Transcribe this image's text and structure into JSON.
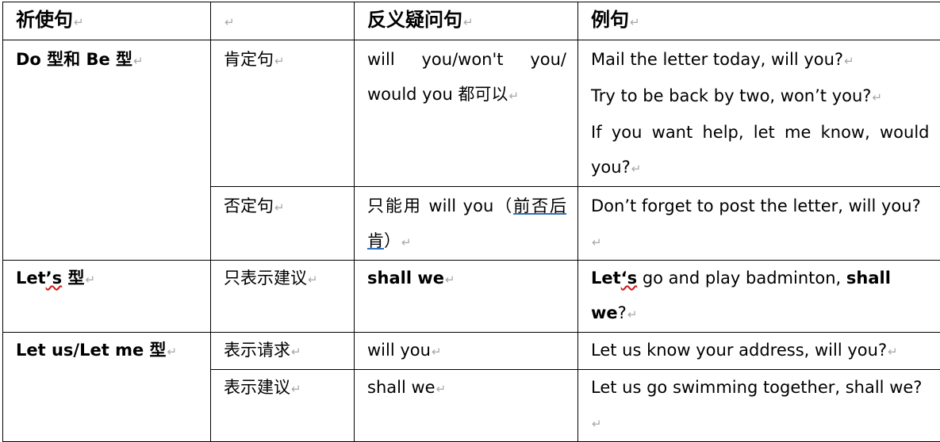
{
  "paragraph_mark": "↵",
  "headers": {
    "c1": "祈使句",
    "c2": "",
    "c3": "反义疑问句",
    "c4": "例句"
  },
  "rows": {
    "do_be": {
      "type": "Do 型和 Be 型",
      "affirm": {
        "kind": "肯定句",
        "tag": "will you/won't you/ would you 都可以",
        "examples": [
          "Mail the letter today, will you?",
          "Try to be back by two, won’t you?",
          "If you want help, let me know, would you?"
        ]
      },
      "neg": {
        "kind": "否定句",
        "tag_a": "只能用 will you（",
        "tag_b": "前否后肯",
        "tag_c": "）",
        "example": "Don’t forget to post the letter, will you?"
      }
    },
    "lets": {
      "type_a": "Let",
      "type_b": "’s",
      "type_c": " 型",
      "kind": "只表示建议",
      "tag": "shall we",
      "ex_a": "Let",
      "ex_b": "‘s",
      "ex_c": " go and play badminton, ",
      "ex_d": "shall we",
      "ex_e": "?"
    },
    "let_us": {
      "type": "Let us/Let me 型",
      "request": {
        "kind": "表示请求",
        "tag": "will you",
        "example": "Let us know your address, will you?"
      },
      "suggest": {
        "kind": "表示建议",
        "tag": "shall we",
        "example": "Let us go swimming together, shall we?"
      }
    }
  }
}
